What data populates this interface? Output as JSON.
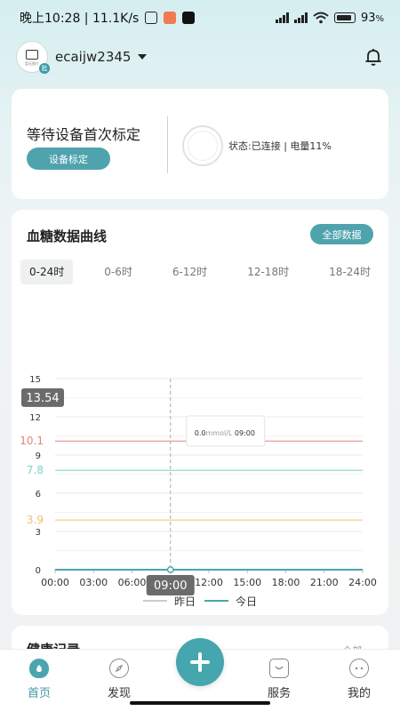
{
  "status_bar": {
    "time_speed": "晚上10:28 | 11.1K/s",
    "battery": "93",
    "battery_unit": "%"
  },
  "header": {
    "username": "ecaijw2345",
    "avatar_caption": "暂无图片",
    "avatar_badge": "批"
  },
  "device": {
    "title": "等待设备首次标定",
    "calibrate_button": "设备标定",
    "status": "状态:已连接 | 电量11%"
  },
  "chart_section": {
    "title": "血糖数据曲线",
    "all_data_button": "全部数据",
    "range_tabs": [
      "0-24时",
      "0-6时",
      "6-12时",
      "12-18时",
      "18-24时"
    ],
    "active_tab": 0
  },
  "chart_data": {
    "type": "line",
    "x_tick_labels": [
      "00:00",
      "03:00",
      "06:00",
      "09:00",
      "12:00",
      "15:00",
      "18:00",
      "21:00",
      "24:00"
    ],
    "x_range_hours": [
      0,
      24
    ],
    "y_tick_labels": [
      "0",
      "3",
      "6",
      "9",
      "12",
      "15"
    ],
    "ylim": [
      0,
      15
    ],
    "max_label": "13.54",
    "reference_lines": [
      {
        "label": "10.1",
        "value": 10.1,
        "color": "#e0867a"
      },
      {
        "label": "7.8",
        "value": 7.8,
        "color": "#7cd0cb"
      },
      {
        "label": "3.9",
        "value": 3.9,
        "color": "#f0c070"
      }
    ],
    "series": [
      {
        "name": "昨日",
        "color": "#cccccc",
        "x_hours": [],
        "y": []
      },
      {
        "name": "今日",
        "color": "#4aa5ae",
        "x_hours": [
          0,
          24
        ],
        "y": [
          0,
          0
        ]
      }
    ],
    "crosshair": {
      "x_hours": 9,
      "x_label": "09:00"
    },
    "tooltip": {
      "value": "0.0",
      "unit": "mmol/L",
      "time": "09:00"
    },
    "grid": true,
    "legend_position": "bottom"
  },
  "health_section": {
    "title": "健康记录",
    "more": "全部 >"
  },
  "tabbar": {
    "items": [
      {
        "label": "首页"
      },
      {
        "label": "发现"
      },
      {
        "label": "服务"
      },
      {
        "label": "我的"
      }
    ]
  }
}
